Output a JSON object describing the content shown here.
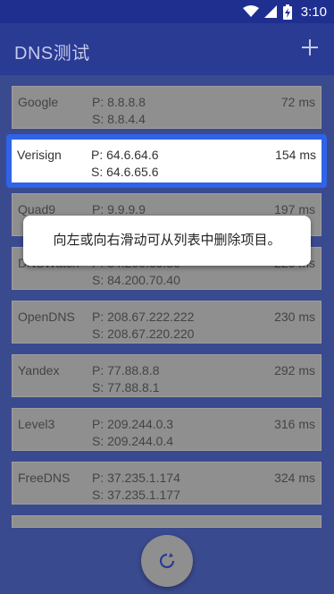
{
  "status": {
    "time": "3:10",
    "icons": [
      "wifi-icon",
      "cell-signal-icon",
      "battery-charging-icon"
    ]
  },
  "app": {
    "title": "DNS测试",
    "add_icon": "plus-icon"
  },
  "servers": [
    {
      "name": "Google",
      "primary": "P: 8.8.8.8",
      "secondary": "S: 8.8.4.4",
      "latency": "72 ms"
    },
    {
      "name": "Verisign",
      "primary": "P: 64.6.64.6",
      "secondary": "S: 64.6.65.6",
      "latency": "154 ms"
    },
    {
      "name": "Quad9",
      "primary": "P: 9.9.9.9",
      "secondary": "",
      "latency": "197 ms"
    },
    {
      "name": "DNSWatch",
      "primary": "P: 84.200.69.80",
      "secondary": "S: 84.200.70.40",
      "latency": "220 ms"
    },
    {
      "name": "OpenDNS",
      "primary": "P: 208.67.222.222",
      "secondary": "S: 208.67.220.220",
      "latency": "230 ms"
    },
    {
      "name": "Yandex",
      "primary": "P: 77.88.8.8",
      "secondary": "S: 77.88.8.1",
      "latency": "292 ms"
    },
    {
      "name": "Level3",
      "primary": "P: 209.244.0.3",
      "secondary": "S: 209.244.0.4",
      "latency": "316 ms"
    },
    {
      "name": "FreeDNS",
      "primary": "P: 37.235.1.174",
      "secondary": "S: 37.235.1.177",
      "latency": "324 ms"
    }
  ],
  "toast": {
    "message": "向左或向右滑动可从列表中删除项目。"
  },
  "fab": {
    "icon": "refresh-icon"
  },
  "colors": {
    "appbar": "#2a3b94",
    "statusbar": "#1f2f8f",
    "selection": "#2f63e8",
    "card": "#8f8f8f"
  }
}
